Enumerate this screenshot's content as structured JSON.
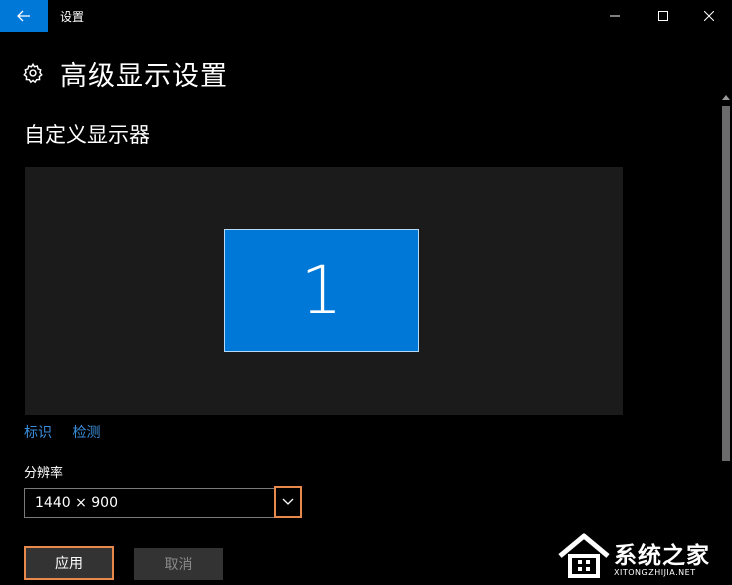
{
  "window": {
    "app_title": "设置"
  },
  "header": {
    "title": "高级显示设置"
  },
  "display": {
    "section_title": "自定义显示器",
    "monitor_number": "1",
    "identify_link": "标识",
    "detect_link": "检测"
  },
  "resolution": {
    "label": "分辨率",
    "selected_value": "1440 × 900"
  },
  "buttons": {
    "apply": "应用",
    "cancel": "取消"
  },
  "watermark": {
    "brand": "系统之家",
    "url": "XITONGZHIJIA.NET"
  },
  "colors": {
    "accent": "#0078d7",
    "highlight": "#e8884a",
    "link": "#3a8edb",
    "background": "#000000"
  },
  "icons": [
    "back-arrow-icon",
    "minimize-icon",
    "maximize-icon",
    "close-icon",
    "gear-icon",
    "chevron-down-icon",
    "scroll-up-icon"
  ]
}
